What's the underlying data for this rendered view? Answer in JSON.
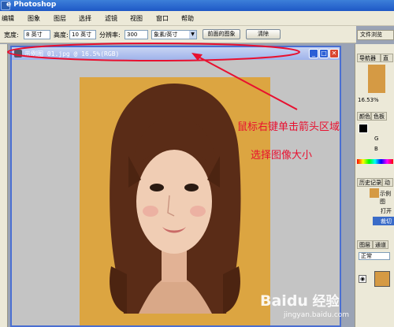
{
  "window": {
    "title": "e Photoshop"
  },
  "menu": [
    "编辑",
    "图象",
    "图层",
    "选择",
    "滤镜",
    "视图",
    "窗口",
    "帮助"
  ],
  "options": {
    "width_label": "宽度:",
    "width_value": "8 英寸",
    "height_label": "高度:",
    "height_value": "10 英寸",
    "resolution_label": "分辨率:",
    "resolution_value": "300",
    "unit_value": "象素/英寸",
    "front_image_button": "前面的图象",
    "clear_button": "清除"
  },
  "panels": {
    "file_browser_tab": "文件浏览",
    "navigator_tab": "导航器",
    "info_tab": "直",
    "zoom": "16.53%",
    "color_tab": "颜色",
    "swatches_tab": "色板",
    "channel_g": "G",
    "channel_b": "B",
    "history_tab": "历史记录",
    "history_tab2": "动",
    "history_snapshot": "示例图",
    "history_item_open": "打开",
    "history_item_crop": "裁切",
    "layers_tab": "图层",
    "channels_tab": "通道",
    "blend_mode": "正常"
  },
  "document": {
    "title": "示例图 01.jpg @ 16.5%(RGB)"
  },
  "annotations": {
    "line1": "鼠标右键单击箭头区域",
    "line2": "选择图像大小"
  },
  "watermark": {
    "brand": "Baidu",
    "text": "经验",
    "url": "jingyan.baidu.com"
  },
  "colors": {
    "annotation": "#e8102f",
    "titlebar": "#1f58c6",
    "doc_border": "#4a6fd2",
    "canvas_bg": "#d9a03b"
  }
}
